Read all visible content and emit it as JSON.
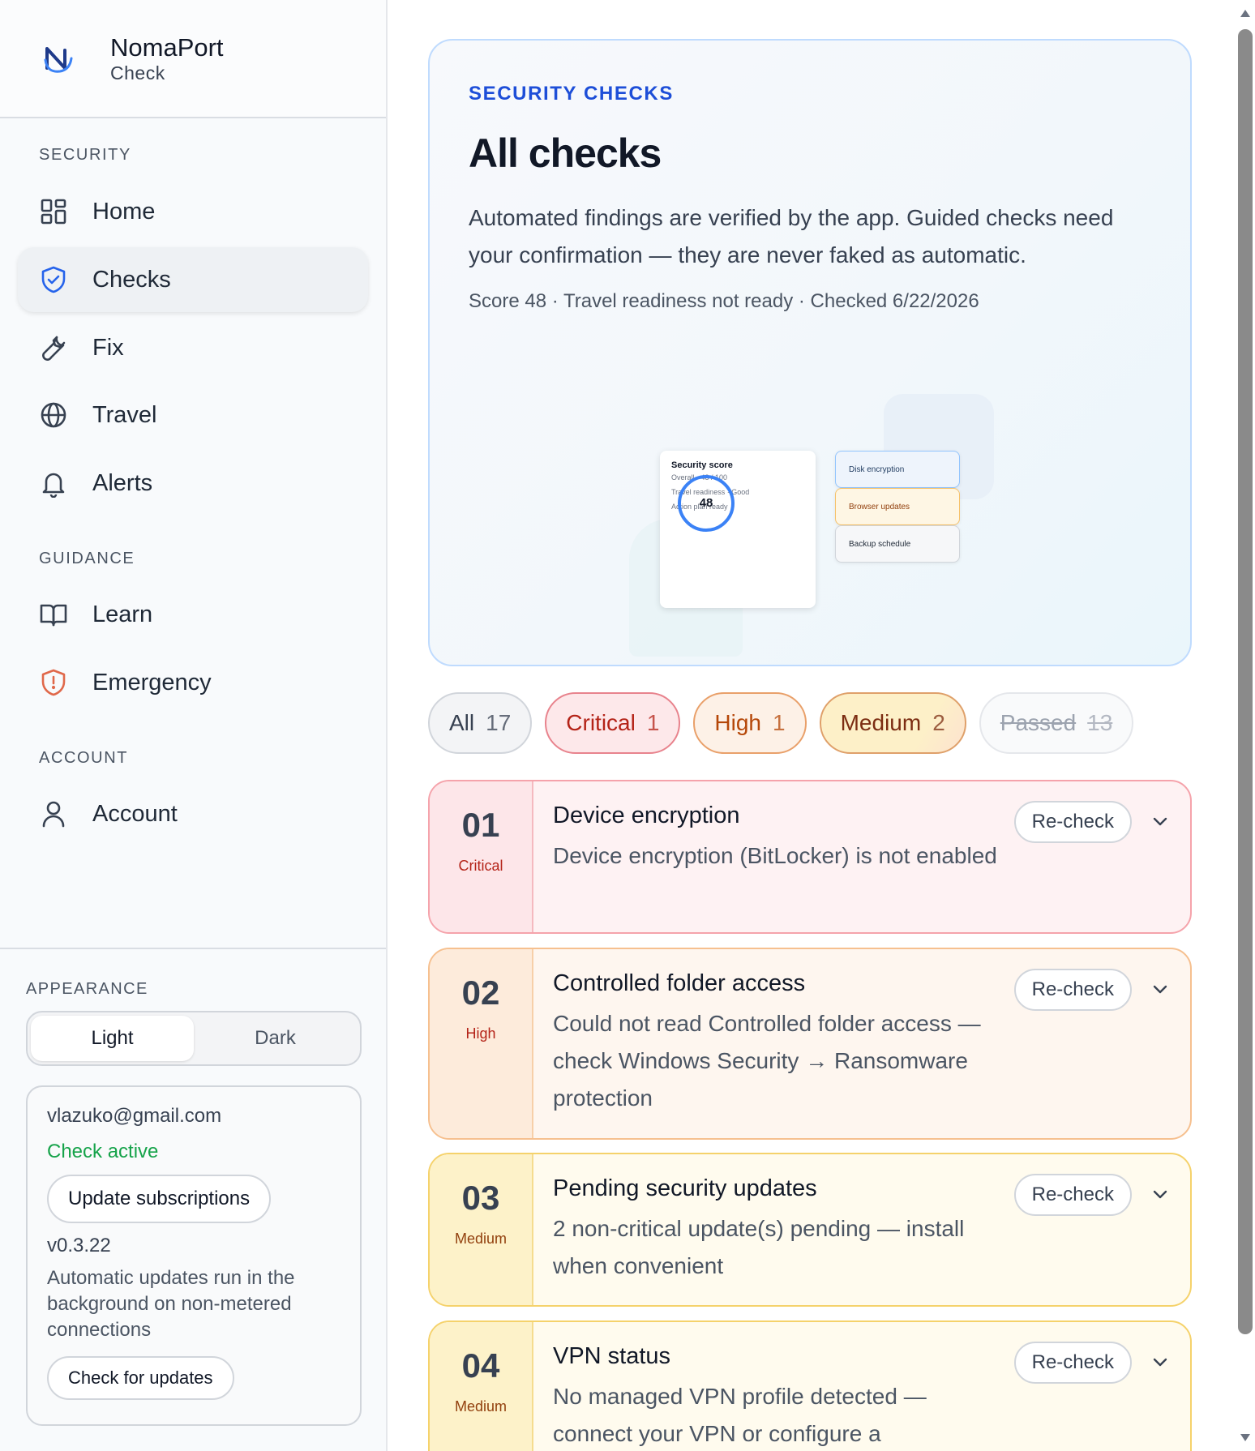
{
  "brand": {
    "name": "NomaPort",
    "sub": "Check"
  },
  "nav": {
    "sections": [
      "SECURITY",
      "GUIDANCE",
      "ACCOUNT"
    ],
    "items": [
      {
        "label": "Home",
        "icon": "grid-icon"
      },
      {
        "label": "Checks",
        "icon": "shield-check-icon",
        "active": true
      },
      {
        "label": "Fix",
        "icon": "wrench-icon"
      },
      {
        "label": "Travel",
        "icon": "globe-icon"
      },
      {
        "label": "Alerts",
        "icon": "bell-icon"
      },
      {
        "label": "Learn",
        "icon": "book-icon"
      },
      {
        "label": "Emergency",
        "icon": "shield-alert-icon"
      },
      {
        "label": "Account",
        "icon": "user-icon"
      }
    ]
  },
  "appearance": {
    "label": "APPEARANCE",
    "light": "Light",
    "dark": "Dark",
    "selected": "Light"
  },
  "account": {
    "email": "vlazuko@gmail.com",
    "status": "Check active",
    "update_subs": "Update subscriptions",
    "version": "v0.3.22",
    "note": "Automatic updates run in the background on non-metered connections",
    "check_updates": "Check for updates"
  },
  "hero": {
    "eyebrow": "SECURITY CHECKS",
    "title": "All checks",
    "desc": "Automated findings are verified by the app. Guided checks need your confirmation — they are never faked as automatic.",
    "meta": "Score 48 · Travel readiness not ready · Checked 6/22/2026",
    "illus": {
      "score_title": "Security score",
      "line1": "Overall · 48 / 100",
      "line2": "Travel readiness · Good",
      "line3": "Action plan ready",
      "score": "48",
      "chips": [
        "Disk encryption",
        "Browser updates",
        "Backup schedule"
      ]
    }
  },
  "filters": [
    {
      "label": "All",
      "count": "17"
    },
    {
      "label": "Critical",
      "count": "1"
    },
    {
      "label": "High",
      "count": "1"
    },
    {
      "label": "Medium",
      "count": "2"
    },
    {
      "label": "Passed",
      "count": "13"
    }
  ],
  "findings": [
    {
      "num": "01",
      "severity": "Critical",
      "title": "Device encryption",
      "desc": "Device encryption (BitLocker) is not enabled",
      "action": "Re-check"
    },
    {
      "num": "02",
      "severity": "High",
      "title": "Controlled folder access",
      "desc": "Could not read Controlled folder access — check Windows Security → Ransomware protection",
      "action": "Re-check"
    },
    {
      "num": "03",
      "severity": "Medium",
      "title": "Pending security updates",
      "desc": "2 non-critical update(s) pending — install when convenient",
      "action": "Re-check"
    },
    {
      "num": "04",
      "severity": "Medium",
      "title": "VPN status",
      "desc": "No managed VPN profile detected — connect your VPN or configure a",
      "action": "Re-check"
    }
  ],
  "colors": {
    "accent": "#1d4ed8",
    "critical_bg": "#fde8ea",
    "critical_border": "#f5a3ab",
    "critical_text": "#b42318",
    "high_bg": "#fdf1e7",
    "high_border": "#f6c08f",
    "high_text": "#b54708",
    "medium_bg": "#fef8e6",
    "medium_border": "#f5d26b",
    "medium_text": "#92400e",
    "success": "#16a34a"
  }
}
